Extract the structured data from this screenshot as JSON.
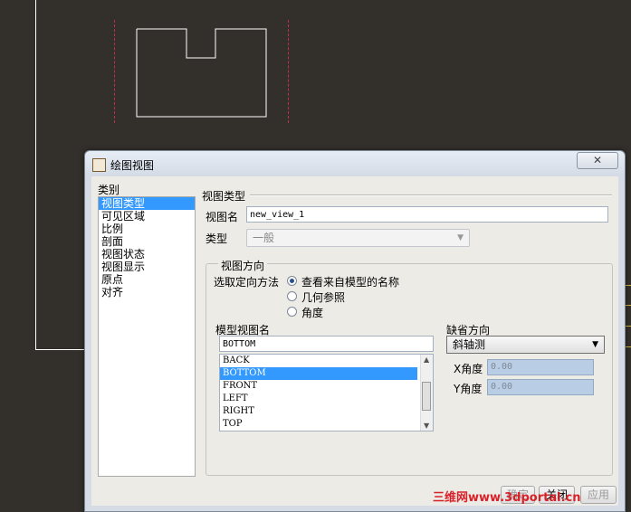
{
  "dialog": {
    "title": "绘图视图",
    "close_glyph": "✕"
  },
  "categories": {
    "label": "类别",
    "items": [
      "视图类型",
      "可见区域",
      "比例",
      "剖面",
      "视图状态",
      "视图显示",
      "原点",
      "对齐"
    ],
    "selected": "视图类型"
  },
  "view_type": {
    "section_title": "视图类型",
    "view_name_label": "视图名",
    "view_name_value": "new_view_1",
    "type_label": "类型",
    "type_value": "一般"
  },
  "orientation": {
    "section_title": "视图方向",
    "method_label": "选取定向方法",
    "options": [
      "查看来自模型的名称",
      "几何参照",
      "角度"
    ],
    "selected_option": "查看来自模型的名称",
    "model_view_label": "模型视图名",
    "model_view_value": "BOTTOM",
    "model_views": [
      "BACK",
      "BOTTOM",
      "FRONT",
      "LEFT",
      "RIGHT",
      "TOP"
    ],
    "selected_view": "BOTTOM",
    "default_orientation_label": "缺省方向",
    "default_orientation_value": "斜轴测",
    "x_angle_label": "X角度",
    "x_angle_value": "0.00",
    "y_angle_label": "Y角度",
    "y_angle_value": "0.00"
  },
  "buttons": {
    "ok": "确定",
    "close": "关闭",
    "apply": "应用"
  },
  "watermark": "三维网www.3dportal.cn",
  "colors": {
    "canvas_bg": "#33302c",
    "selection": "#3399ff",
    "dash_line": "#c0304a"
  }
}
